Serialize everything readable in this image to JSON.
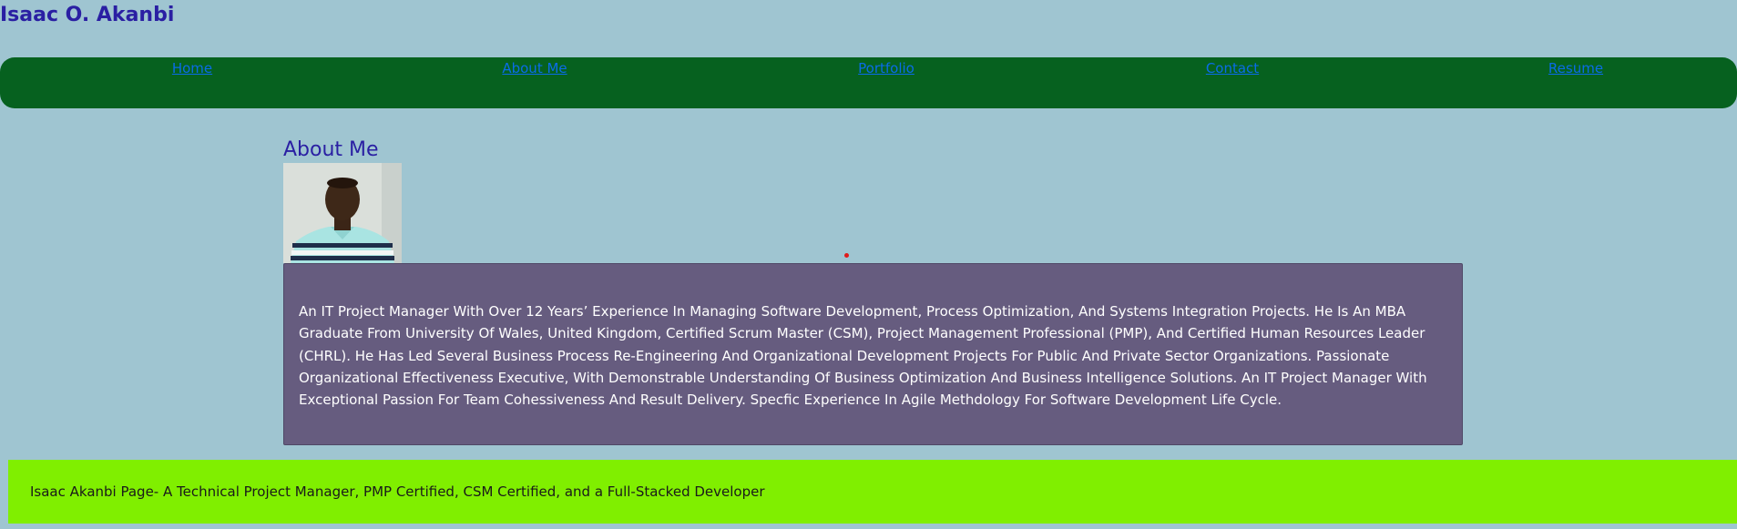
{
  "header": {
    "title": "Isaac O. Akanbi"
  },
  "nav": {
    "items": [
      {
        "label": "Home"
      },
      {
        "label": "About Me"
      },
      {
        "label": "Portfolio"
      },
      {
        "label": "Contact"
      },
      {
        "label": "Resume"
      }
    ]
  },
  "main": {
    "heading": "About Me",
    "bio": "An IT Project Manager With Over 12 Years’ Experience In Managing Software Development, Process Optimization, And Systems Integration Projects. He Is An MBA Graduate From University Of Wales, United Kingdom, Certified Scrum Master (CSM), Project Management Professional (PMP), And Certified Human Resources Leader (CHRL). He Has Led Several Business Process Re-Engineering And Organizational Development Projects For Public And Private Sector Organizations. Passionate Organizational Effectiveness Executive, With Demonstrable Understanding Of Business Optimization And Business Intelligence Solutions. An IT Project Manager With Exceptional Passion For Team Cohessiveness And Result Delivery. Specfic Experience In Agile Methdology For Software Development Life Cycle."
  },
  "footer": {
    "text": "Isaac Akanbi Page- A Technical Project Manager, PMP Certified, CSM Certified, and a Full-Stacked Developer"
  },
  "colors": {
    "page_background": "#9fc5d1",
    "title_text": "#2a1fa3",
    "nav_background": "#06611f",
    "nav_link": "#0a6ce8",
    "bio_background": "#665c7f",
    "footer_background": "#80ef00"
  }
}
